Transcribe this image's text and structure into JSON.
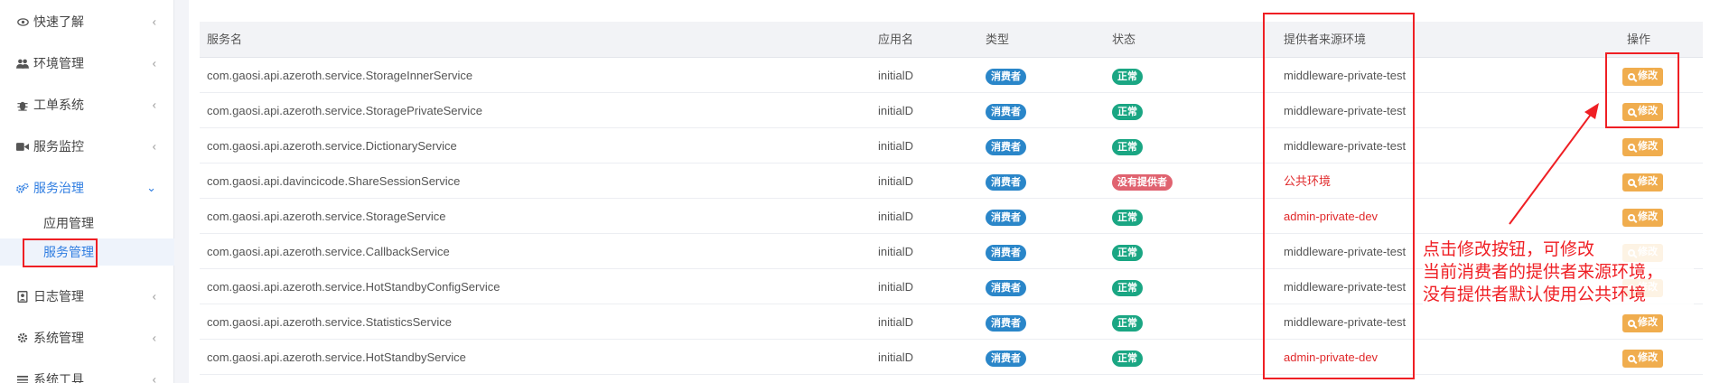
{
  "sidebar": {
    "items": [
      {
        "label": "快速了解",
        "icon": "eye-icon"
      },
      {
        "label": "环境管理",
        "icon": "users-icon"
      },
      {
        "label": "工单系统",
        "icon": "bug-icon"
      },
      {
        "label": "服务监控",
        "icon": "video-icon"
      },
      {
        "label": "服务治理",
        "icon": "cogs-icon"
      },
      {
        "label": "日志管理",
        "icon": "log-icon"
      },
      {
        "label": "系统管理",
        "icon": "gear-icon"
      },
      {
        "label": "系统工具",
        "icon": "list-icon"
      }
    ],
    "sub_items": [
      {
        "label": "应用管理"
      },
      {
        "label": "服务管理"
      }
    ]
  },
  "table": {
    "headers": {
      "service": "服务名",
      "app": "应用名",
      "type": "类型",
      "status": "状态",
      "env": "提供者来源环境",
      "action": "操作"
    },
    "edit_label": "修改",
    "rows": [
      {
        "service": "com.gaosi.api.azeroth.service.StorageInnerService",
        "app": "initialD",
        "type": "消费者",
        "status": "正常",
        "env": "middleware-private-test"
      },
      {
        "service": "com.gaosi.api.azeroth.service.StoragePrivateService",
        "app": "initialD",
        "type": "消费者",
        "status": "正常",
        "env": "middleware-private-test"
      },
      {
        "service": "com.gaosi.api.azeroth.service.DictionaryService",
        "app": "initialD",
        "type": "消费者",
        "status": "正常",
        "env": "middleware-private-test"
      },
      {
        "service": "com.gaosi.api.davincicode.ShareSessionService",
        "app": "initialD",
        "type": "消费者",
        "status": "没有提供者",
        "env": "公共环境"
      },
      {
        "service": "com.gaosi.api.azeroth.service.StorageService",
        "app": "initialD",
        "type": "消费者",
        "status": "正常",
        "env": "admin-private-dev"
      },
      {
        "service": "com.gaosi.api.azeroth.service.CallbackService",
        "app": "initialD",
        "type": "消费者",
        "status": "正常",
        "env": "middleware-private-test"
      },
      {
        "service": "com.gaosi.api.azeroth.service.HotStandbyConfigService",
        "app": "initialD",
        "type": "消费者",
        "status": "正常",
        "env": "middleware-private-test"
      },
      {
        "service": "com.gaosi.api.azeroth.service.StatisticsService",
        "app": "initialD",
        "type": "消费者",
        "status": "正常",
        "env": "middleware-private-test"
      },
      {
        "service": "com.gaosi.api.azeroth.service.HotStandbyService",
        "app": "initialD",
        "type": "消费者",
        "status": "正常",
        "env": "admin-private-dev"
      }
    ]
  },
  "annotation": {
    "lines": [
      "点击修改按钮，可修改",
      "当前消费者的提供者来源环境，",
      "没有提供者默认使用公共环境"
    ]
  },
  "colors": {
    "accent": "#2f7de1",
    "consumer_badge": "#2a86c9",
    "ok_badge": "#1aa683",
    "no_provider_badge": "#e06370",
    "edit_button": "#f0ad4e",
    "annotation_red": "#ef1f24"
  }
}
